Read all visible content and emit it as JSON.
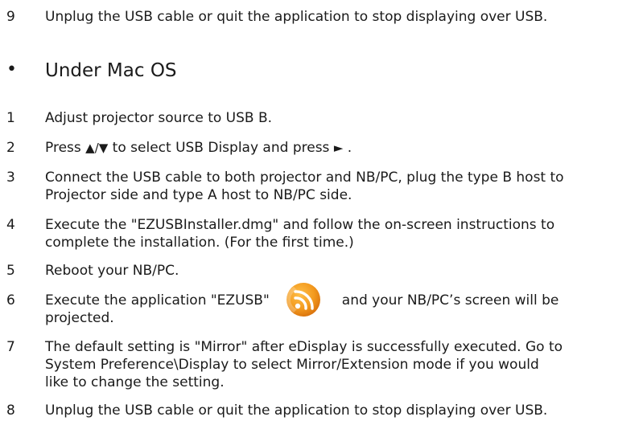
{
  "step9": {
    "num": "9",
    "text": "Unplug the USB cable or quit the application to stop displaying over USB."
  },
  "section": {
    "bullet": "•",
    "title": "Under Mac OS"
  },
  "steps": [
    {
      "num": "1",
      "text": "Adjust projector source to USB B."
    },
    {
      "num": "2",
      "pre": "Press ",
      "up_down": "▲/▼",
      "mid": " to select USB Display and press ",
      "right": "►",
      "post": " ."
    },
    {
      "num": "3",
      "line1": "Connect the USB cable to both projector and NB/PC, plug the type B host to",
      "line2": "Projector side and type A host to NB/PC side."
    },
    {
      "num": "4",
      "line1": "Execute the \"EZUSBInstaller.dmg\" and follow the on-screen instructions to",
      "line2": "complete the installation. (For the first time.)"
    },
    {
      "num": "5",
      "text": "Reboot your NB/PC."
    },
    {
      "num": "6",
      "pre": "Execute the application \"EZUSB\"",
      "icon": "ezusb-app-icon",
      "post": "and your NB/PC’s screen will be",
      "line2": "projected."
    },
    {
      "num": "7",
      "line1": "The default setting is \"Mirror\" after eDisplay is successfully executed. Go to",
      "line2": "System Preference\\Display to select Mirror/Extension mode if you would",
      "line3": "like to change the setting."
    },
    {
      "num": "8",
      "text": "Unplug the USB cable or quit the application to stop displaying over USB."
    }
  ],
  "colors": {
    "text": "#1a1a1a",
    "icon_orange": "#f39a1e",
    "icon_dark": "#e07a10"
  }
}
